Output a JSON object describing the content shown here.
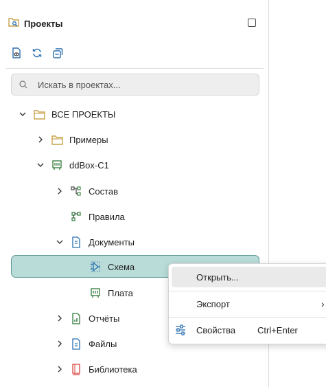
{
  "panel": {
    "title": "Проекты",
    "search_placeholder": "Искать в проектах..."
  },
  "tree": {
    "root": "ВСЕ ПРОЕКТЫ",
    "examples": "Примеры",
    "project": "ddBox-C1",
    "composition": "Состав",
    "rules": "Правила",
    "documents": "Документы",
    "schema": "Схема",
    "board": "Плата",
    "reports": "Отчёты",
    "files": "Файлы",
    "library": "Библиотека"
  },
  "context_menu": {
    "open": "Открыть...",
    "export": "Экспорт",
    "export_arrow": "›",
    "properties": "Свойства",
    "properties_shortcut": "Ctrl+Enter"
  },
  "colors": {
    "selection_bg": "#b9dcd8",
    "selection_border": "#5c9a95",
    "folder": "#c9a24a",
    "board_icon": "#2f7a3a",
    "doc_icon": "#2a6fb0",
    "library_icon": "#d9534f"
  },
  "icons": [
    "projects-icon",
    "preview-icon",
    "refresh-icon",
    "collapse-icon",
    "search-icon",
    "folder-icon",
    "board-icon",
    "composition-icon",
    "rules-icon",
    "document-icon",
    "schematic-icon",
    "reports-icon",
    "file-icon",
    "library-icon",
    "settings-sliders-icon"
  ]
}
